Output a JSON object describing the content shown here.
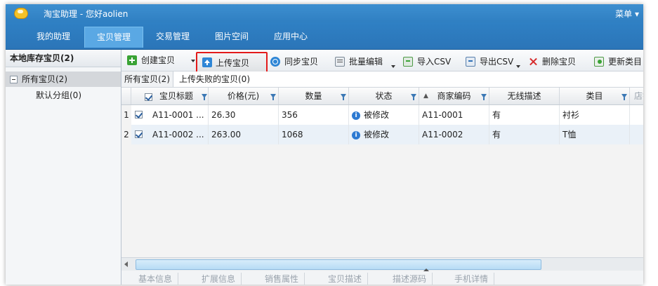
{
  "app": {
    "title": "淘宝助理 - 您好aolien",
    "menu_label": "菜单"
  },
  "nav": [
    {
      "label": "我的助理"
    },
    {
      "label": "宝贝管理"
    },
    {
      "label": "交易管理"
    },
    {
      "label": "图片空间"
    },
    {
      "label": "应用中心"
    }
  ],
  "sidebar": {
    "header": "本地库存宝贝(2)",
    "items": [
      {
        "label": "所有宝贝(2)"
      },
      {
        "label": "默认分组(0)"
      }
    ]
  },
  "toolbar": {
    "create": "创建宝贝",
    "upload": "上传宝贝",
    "sync": "同步宝贝",
    "batch_edit": "批量编辑",
    "import_csv": "导入CSV",
    "export_csv": "导出CSV",
    "delete": "删除宝贝",
    "update_category": "更新类目"
  },
  "subtabs": [
    {
      "label": "所有宝贝(2)"
    },
    {
      "label": "上传失败的宝贝(0)"
    }
  ],
  "table": {
    "headers": {
      "title": "宝贝标题",
      "price": "价格(元)",
      "quantity": "数量",
      "status": "状态",
      "sku": "商家编码",
      "mobile": "无线描述",
      "category": "类目",
      "shop": "店铺"
    },
    "rows": [
      {
        "num": "1",
        "title": "A11-0001 ...",
        "price": "26.30",
        "quantity": "356",
        "status": "被修改",
        "sku": "A11-0001",
        "mobile": "有",
        "category": "衬衫"
      },
      {
        "num": "2",
        "title": "A11-0002 ...",
        "price": "263.00",
        "quantity": "1068",
        "status": "被修改",
        "sku": "A11-0002",
        "mobile": "有",
        "category": "T恤"
      }
    ]
  },
  "bottom_tabs": [
    {
      "label": "基本信息"
    },
    {
      "label": "扩展信息"
    },
    {
      "label": "销售属性"
    },
    {
      "label": "宝贝描述"
    },
    {
      "label": "描述源码"
    },
    {
      "label": "手机详情"
    }
  ]
}
